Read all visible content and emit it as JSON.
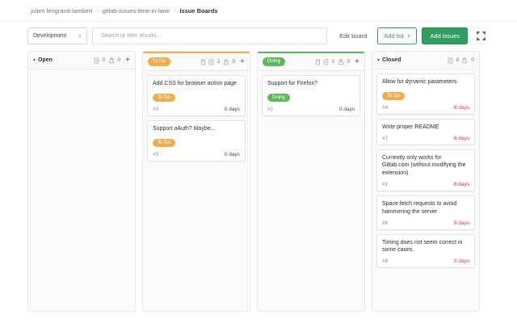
{
  "breadcrumb": {
    "items": [
      "julien lengrand-lambert",
      "gitlab-issues-time-in-lane"
    ],
    "separator": "›",
    "current": "Issue Boards"
  },
  "toolbar": {
    "board_select_value": "Development",
    "select_chevron": "∨",
    "search_placeholder": "Search or filter results...",
    "edit_board_label": "Edit board",
    "add_list_label": "Add list",
    "add_list_chevron": "∨",
    "add_issues_label": "Add issues"
  },
  "icons": {
    "collapse_chevron": "▾",
    "plus": "+",
    "issues_count_icon": "issues-count-icon",
    "weight_icon": "weight-icon",
    "trash_icon": "trash-icon",
    "maximize_icon": "maximize-icon"
  },
  "colors": {
    "button_green": "#2f9e5f",
    "label_orange": "#f0ad4e",
    "label_green": "#5cb85c",
    "overdue_red": "#e53935"
  },
  "board": {
    "lists": [
      {
        "title": "Open",
        "style": "default",
        "accent": null,
        "issues_count": 0,
        "weight": 0,
        "has_delete": false,
        "has_add": true,
        "cards": []
      },
      {
        "title": "To Do",
        "style": "label",
        "accent": "#f0ad4e",
        "issues_count": 2,
        "weight": 0,
        "has_delete": true,
        "has_add": true,
        "cards": [
          {
            "title": "Add CSS for browser action page",
            "label": "To Do",
            "label_color": "#f0ad4e",
            "ref": "#3",
            "days": "0 days",
            "overdue": false
          },
          {
            "title": "Support oAuth? Maybe...",
            "label": "To Do",
            "label_color": "#f0ad4e",
            "ref": "#5",
            "days": "0 days",
            "overdue": false
          }
        ]
      },
      {
        "title": "Doing",
        "style": "label",
        "accent": "#5cb85c",
        "issues_count": 1,
        "weight": 0,
        "has_delete": true,
        "has_add": true,
        "cards": [
          {
            "title": "Support for Firefox?",
            "label": "Doing",
            "label_color": "#5cb85c",
            "ref": "#2",
            "days": "0 days",
            "overdue": false
          }
        ]
      },
      {
        "title": "Closed",
        "style": "default",
        "accent": null,
        "issues_count": 5,
        "weight": 0,
        "has_delete": false,
        "has_add": false,
        "cards": [
          {
            "title": "Allow for dynamic parameters",
            "label": "To Do",
            "label_color": "#f0ad4e",
            "ref": "#4",
            "days": "6 days",
            "overdue": true
          },
          {
            "title": "Write proper README",
            "label": null,
            "ref": "#7",
            "days": "6 days",
            "overdue": true
          },
          {
            "title": "Currently only works for Gitlab.com (without modifying the extension)",
            "label": null,
            "ref": "#1",
            "days": "6 days",
            "overdue": true
          },
          {
            "title": "Space fetch requests to avoid hammering the server",
            "label": null,
            "ref": "#6",
            "days": "9 days",
            "overdue": true
          },
          {
            "title": "Timing does not seem correct in some cases.",
            "label": null,
            "ref": "#8",
            "days": "3 days",
            "overdue": true
          }
        ]
      }
    ]
  }
}
